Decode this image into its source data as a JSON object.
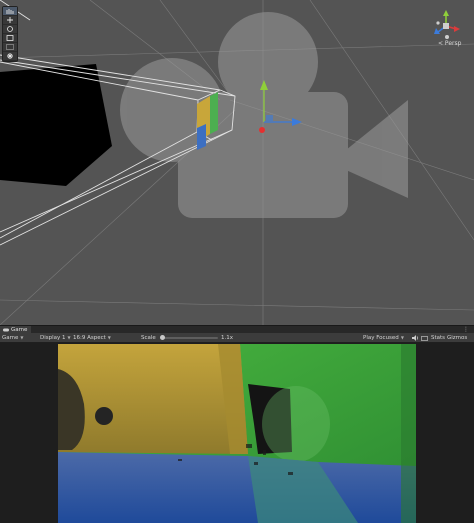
{
  "scene_view": {
    "toolbar": {
      "tools": [
        {
          "name": "hand-tool-icon",
          "active": true
        },
        {
          "name": "move-tool-icon",
          "active": false
        },
        {
          "name": "rotate-tool-icon",
          "active": false
        },
        {
          "name": "scale-tool-icon",
          "active": false
        },
        {
          "name": "rect-tool-icon",
          "active": false
        },
        {
          "name": "transform-tool-icon",
          "active": false
        }
      ]
    },
    "gizmo": {
      "projection_label": "< Persp",
      "axis_colors": {
        "x": "#db3b3b",
        "y": "#8fcf3a",
        "z": "#3b7bdb"
      }
    },
    "colors": {
      "background": "#545454",
      "grid_line": "#8c8c8c",
      "frustum_line": "#e2e2e2",
      "camera_watermark": "#9a9a9a",
      "dark_mesh": "#000000"
    }
  },
  "game_view": {
    "tab": {
      "icon": "gamepad-icon",
      "label": "Game"
    },
    "controls": {
      "mode_label": "Game",
      "display_label": "Display 1",
      "aspect_label": "16:9 Aspect",
      "scale_label": "Scale",
      "scale_value": "1.1x",
      "play_mode_label": "Play Focused",
      "stats_label": "Stats",
      "gizmos_label": "Gizmos"
    },
    "feed_colors": {
      "box_yellow": "#bfa23a",
      "backdrop_green": "#3ea33a",
      "floor_blue": "#2f5aa8",
      "shadow": "#1a1a1a"
    }
  }
}
